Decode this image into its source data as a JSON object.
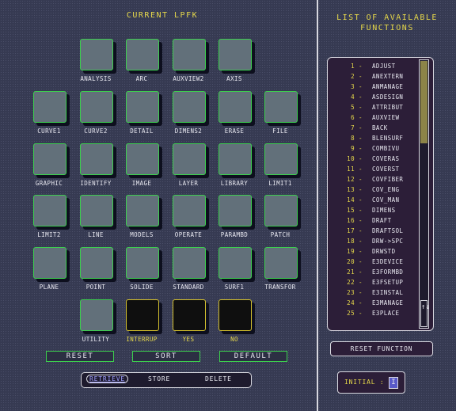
{
  "header": {
    "left_title": "CURRENT LPFK",
    "right_title_line1": "LIST OF AVAILABLE",
    "right_title_line2": "FUNCTIONS"
  },
  "keys": [
    {
      "label": "ANALYSIS",
      "style": "green"
    },
    {
      "label": "ARC",
      "style": "green"
    },
    {
      "label": "AUXVIEW2",
      "style": "green"
    },
    {
      "label": "AXIS",
      "style": "green"
    },
    {
      "label": "CURVE1",
      "style": "green"
    },
    {
      "label": "CURVE2",
      "style": "green"
    },
    {
      "label": "DETAIL",
      "style": "green"
    },
    {
      "label": "DIMENS2",
      "style": "green"
    },
    {
      "label": "ERASE",
      "style": "green"
    },
    {
      "label": "FILE",
      "style": "green"
    },
    {
      "label": "GRAPHIC",
      "style": "green"
    },
    {
      "label": "IDENTIFY",
      "style": "green"
    },
    {
      "label": "IMAGE",
      "style": "green"
    },
    {
      "label": "LAYER",
      "style": "green"
    },
    {
      "label": "LIBRARY",
      "style": "green"
    },
    {
      "label": "LIMIT1",
      "style": "green"
    },
    {
      "label": "LIMIT2",
      "style": "green"
    },
    {
      "label": "LINE",
      "style": "green"
    },
    {
      "label": "MODELS",
      "style": "green"
    },
    {
      "label": "OPERATE",
      "style": "green"
    },
    {
      "label": "PARAMBD",
      "style": "green"
    },
    {
      "label": "PATCH",
      "style": "green"
    },
    {
      "label": "PLANE",
      "style": "green"
    },
    {
      "label": "POINT",
      "style": "green"
    },
    {
      "label": "SOLIDE",
      "style": "green"
    },
    {
      "label": "STANDARD",
      "style": "green"
    },
    {
      "label": "SURF1",
      "style": "green"
    },
    {
      "label": "TRANSFOR",
      "style": "green"
    },
    {
      "label": "UTILITY",
      "style": "green"
    },
    {
      "label": "INTERRUP",
      "style": "yellow"
    },
    {
      "label": "YES",
      "style": "yellow"
    },
    {
      "label": "NO",
      "style": "yellow"
    }
  ],
  "buttons": {
    "reset": "RESET",
    "sort": "SORT",
    "default": "DEFAULT"
  },
  "file_bar": {
    "retrieve": "RETRIEVE",
    "store": "STORE",
    "delete": "DELETE",
    "selected": "RETRIEVE"
  },
  "functions": [
    {
      "num": "1",
      "name": "ADJUST"
    },
    {
      "num": "2",
      "name": "ANEXTERN"
    },
    {
      "num": "3",
      "name": "ANMANAGE"
    },
    {
      "num": "4",
      "name": "ASDESIGN"
    },
    {
      "num": "5",
      "name": "ATTRIBUT"
    },
    {
      "num": "6",
      "name": "AUXVIEW"
    },
    {
      "num": "7",
      "name": "BACK"
    },
    {
      "num": "8",
      "name": "BLENSURF"
    },
    {
      "num": "9",
      "name": "COMBIVU"
    },
    {
      "num": "10",
      "name": "COVERAS"
    },
    {
      "num": "11",
      "name": "COVERST"
    },
    {
      "num": "12",
      "name": "COVFIBER"
    },
    {
      "num": "13",
      "name": "COV_ENG"
    },
    {
      "num": "14",
      "name": "COV_MAN"
    },
    {
      "num": "15",
      "name": "DIMENS"
    },
    {
      "num": "16",
      "name": "DRAFT"
    },
    {
      "num": "17",
      "name": "DRAFTSOL"
    },
    {
      "num": "18",
      "name": "DRW->SPC"
    },
    {
      "num": "19",
      "name": "DRWSTD"
    },
    {
      "num": "20",
      "name": "E3DEVICE"
    },
    {
      "num": "21",
      "name": "E3FORMBD"
    },
    {
      "num": "22",
      "name": "E3FSETUP"
    },
    {
      "num": "23",
      "name": "E3INSTAL"
    },
    {
      "num": "24",
      "name": "E3MANAGE"
    },
    {
      "num": "25",
      "name": "E3PLACE"
    }
  ],
  "dash": "-",
  "reset_function": "RESET FUNCTION",
  "initial": {
    "label": "INITIAL :",
    "value": "I"
  },
  "scroll": {
    "arrows": "↑↓"
  },
  "colors": {
    "accent_green": "#3ccf4e",
    "accent_yellow": "#e6d84a",
    "background": "#363a52"
  }
}
